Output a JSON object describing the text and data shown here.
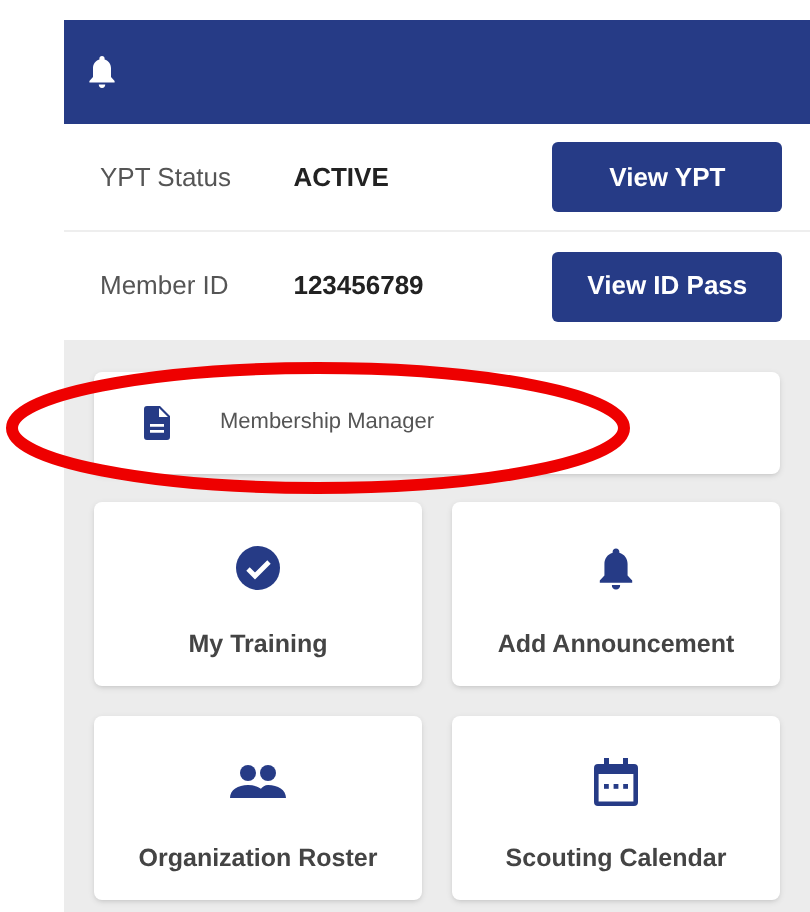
{
  "info_rows": [
    {
      "label": "YPT Status",
      "value": "ACTIVE",
      "button": "View YPT"
    },
    {
      "label": "Member ID",
      "value": "123456789",
      "button": "View ID Pass"
    }
  ],
  "shortcut": {
    "label": "Membership Manager"
  },
  "tiles": [
    {
      "label": "My Training"
    },
    {
      "label": "Add Announcement"
    },
    {
      "label": "Organization Roster"
    },
    {
      "label": "Scouting Calendar"
    }
  ],
  "annotation": {
    "kind": "ellipse",
    "color": "#ee0000"
  }
}
